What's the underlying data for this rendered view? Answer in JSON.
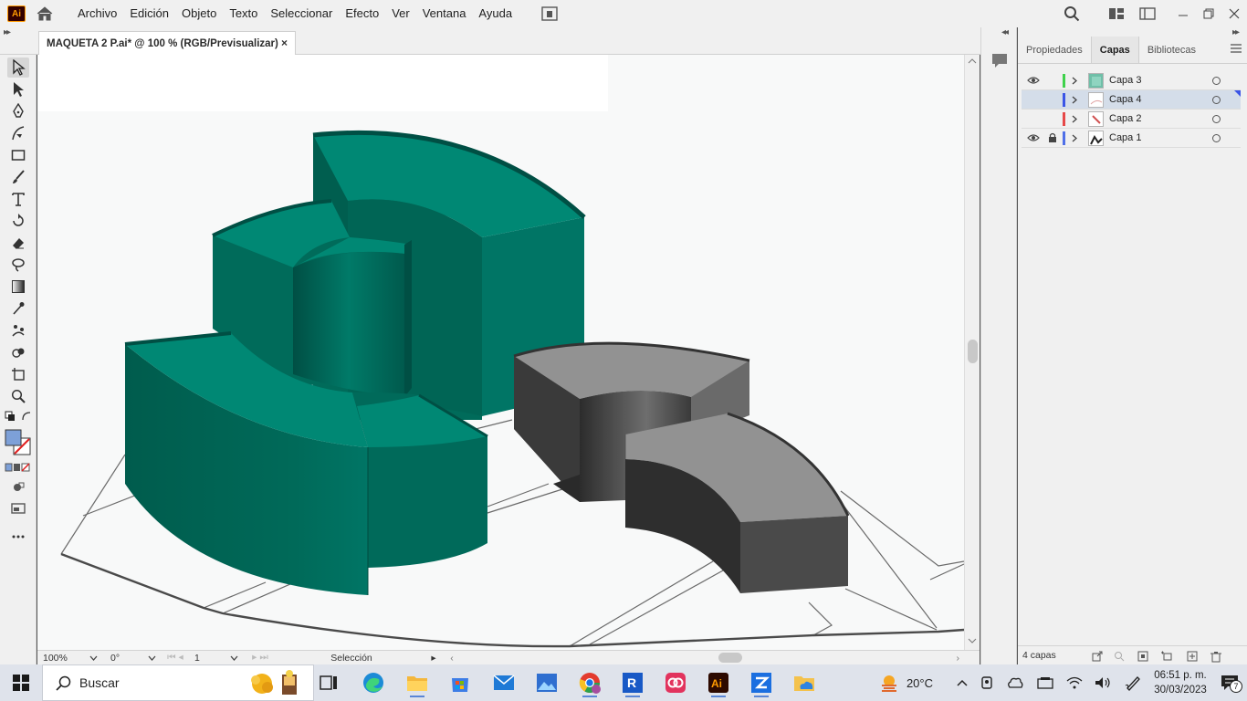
{
  "app": {
    "logo_text": "Ai",
    "menus": [
      "Archivo",
      "Edición",
      "Objeto",
      "Texto",
      "Seleccionar",
      "Efecto",
      "Ver",
      "Ventana",
      "Ayuda"
    ]
  },
  "document": {
    "tab_title": "MAQUETA 2 P.ai* @ 100 % (RGB/Previsualizar)",
    "close_glyph": "×"
  },
  "colors": {
    "teal_top": "#008874",
    "teal_side": "#006b5a",
    "teal_dark": "#005a4b",
    "gray_top": "#929292",
    "gray_side": "#3a3a3a",
    "gray_dark": "#2a2a2a",
    "selection_blue": "#d4dde9"
  },
  "tools": [
    "selection-tool",
    "direct-selection-tool",
    "pen-tool",
    "curvature-tool",
    "rectangle-tool",
    "paintbrush-tool",
    "type-tool",
    "rotate-tool",
    "eraser-tool",
    "lasso-tool",
    "gradient-tool",
    "eyedropper-tool",
    "puppet-warp-tool",
    "shape-builder-tool",
    "artboard-tool",
    "zoom-tool"
  ],
  "status": {
    "zoom": "100%",
    "rotation": "0°",
    "artboard": "1",
    "mode": "Selección"
  },
  "panel": {
    "tabs": [
      "Propiedades",
      "Capas",
      "Bibliotecas"
    ],
    "active_tab": "Capas",
    "layers": [
      {
        "name": "Capa 3",
        "visible": true,
        "locked": false,
        "color": "#3fd24c",
        "selected": false
      },
      {
        "name": "Capa 4",
        "visible": false,
        "locked": false,
        "color": "#3b55e6",
        "selected": true
      },
      {
        "name": "Capa 2",
        "visible": false,
        "locked": false,
        "color": "#e64848",
        "selected": false
      },
      {
        "name": "Capa 1",
        "visible": true,
        "locked": true,
        "color": "#4f6fe8",
        "selected": false
      }
    ],
    "layer_count": "4 capas"
  },
  "taskbar": {
    "search_placeholder": "Buscar",
    "weather": "20°C",
    "time": "06:51 p. m.",
    "date": "30/03/2023",
    "notification_count": "7",
    "apps": [
      "task-view",
      "edge",
      "file-explorer",
      "microsoft-store",
      "mail",
      "photos",
      "chrome",
      "revit",
      "creative-cloud",
      "illustrator",
      "zoom-app",
      "onedrive-folder"
    ]
  }
}
